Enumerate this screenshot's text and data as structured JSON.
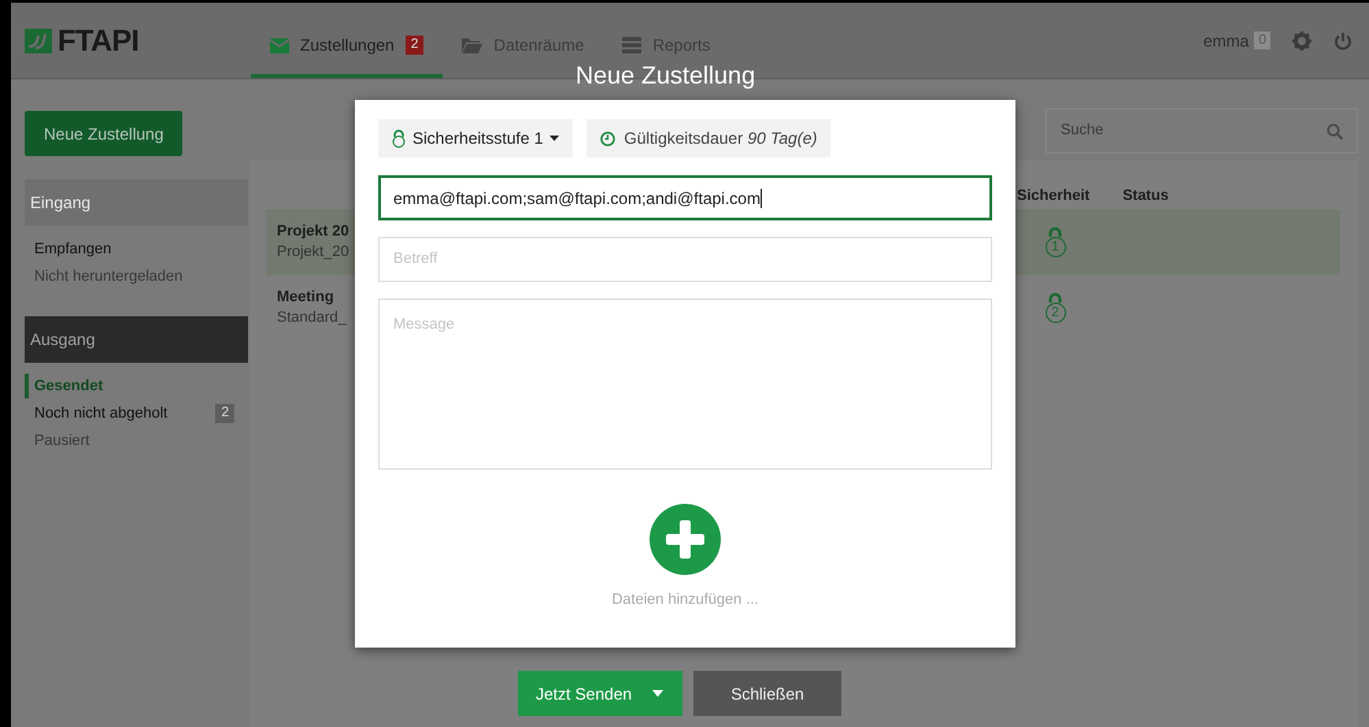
{
  "header": {
    "logo": "FTAPI",
    "tabs": [
      {
        "label": "Zustellungen",
        "kind": "envelope",
        "badge": "2",
        "selected": true
      },
      {
        "label": "Datenräume",
        "kind": "folder",
        "selected": false
      },
      {
        "label": "Reports",
        "kind": "list",
        "selected": false
      }
    ],
    "user": {
      "name": "emma",
      "badge": "0"
    }
  },
  "sidebar": {
    "new_button": "Neue Zustellung",
    "sections": [
      {
        "title": "Eingang",
        "active": false,
        "items": [
          {
            "label": "Empfangen",
            "selected": false,
            "muted": false
          },
          {
            "label": "Nicht heruntergeladen",
            "selected": false,
            "muted": true
          }
        ]
      },
      {
        "title": "Ausgang",
        "active": true,
        "items": [
          {
            "label": "Gesendet",
            "selected": true,
            "muted": false
          },
          {
            "label": "Noch nicht abgeholt",
            "selected": false,
            "muted": false,
            "badge": "2"
          },
          {
            "label": "Pausiert",
            "selected": false,
            "muted": true
          }
        ]
      }
    ]
  },
  "search": {
    "placeholder": "Suche"
  },
  "table": {
    "columns": [
      "Sicherheit",
      "Status"
    ],
    "rows": [
      {
        "title": "Projekt 20",
        "subtitle": "Projekt_20",
        "security": "1",
        "selected": true
      },
      {
        "title": "Meeting",
        "subtitle": "Standard_",
        "security": "2",
        "selected": false
      }
    ]
  },
  "dialog": {
    "title": "Neue Zustellung",
    "security_button": "Sicherheitsstufe 1",
    "validity": "Gültigkeitsdauer *90 Tag(e)*",
    "recipients": "emma@ftapi.com;sam@ftapi.com;andi@ftapi.com",
    "subject_placeholder": "Betreff",
    "message_placeholder": "Message",
    "add_files": "Dateien hinzufügen ...",
    "send_button": "Jetzt Senden",
    "close_button": "Schließen"
  }
}
